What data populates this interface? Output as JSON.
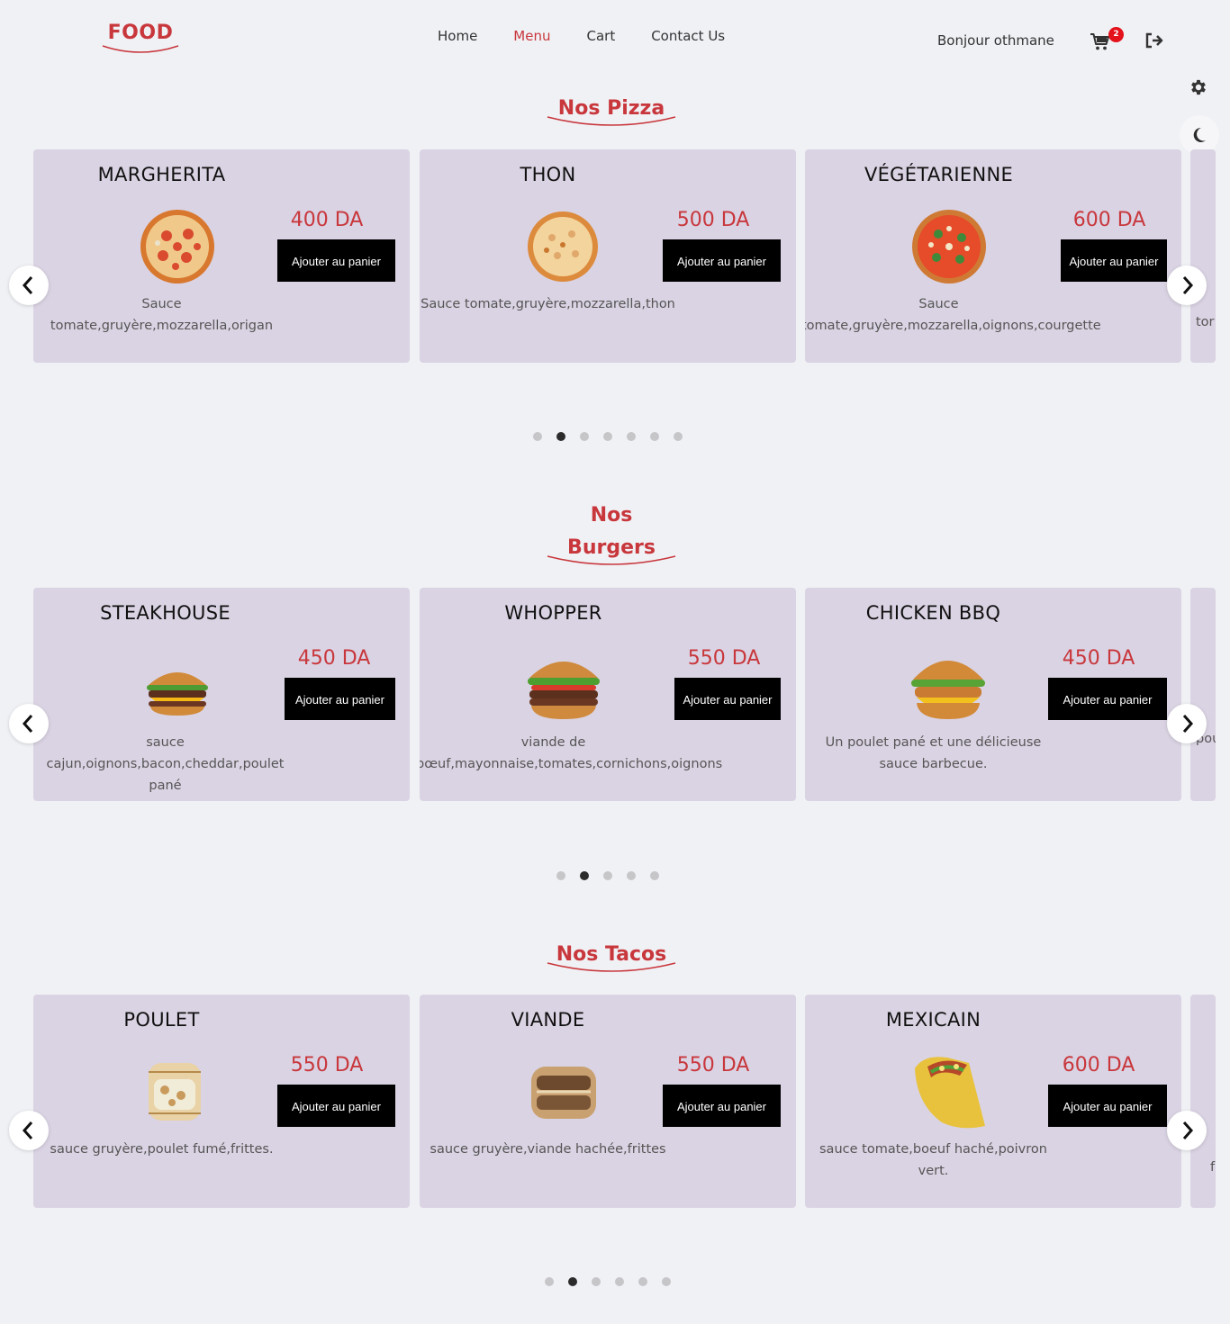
{
  "header": {
    "logo": "FOOD",
    "nav": [
      "Home",
      "Menu",
      "Cart",
      "Contact Us"
    ],
    "active_nav": "Menu",
    "greeting": "Bonjour othmane",
    "cart_count": "2"
  },
  "colors": {
    "accent": "#c8373c",
    "card_bg": "#dad3e3",
    "page_bg": "#f0f1f5",
    "button_bg": "#000000",
    "badge": "#e3121b"
  },
  "sections": [
    {
      "title": "Nos Pizza",
      "items": [
        {
          "name": "MARGHERITA",
          "price": "400 DA",
          "button": "Ajouter au panier",
          "desc": "Sauce tomate,gruyère,mozzarella,origan",
          "icon": "pizza-margherita-image"
        },
        {
          "name": "THON",
          "price": "500 DA",
          "button": "Ajouter au panier",
          "desc": "Sauce tomate,gruyère,mozzarella,thon",
          "icon": "pizza-thon-image"
        },
        {
          "name": "VÉGÉTARIENNE",
          "price": "600 DA",
          "button": "Ajouter au panier",
          "desc": "Sauce tomate,gruyère,mozzarella,oignons,courgette",
          "icon": "pizza-vegetarienne-image"
        }
      ],
      "peek_text": "tor",
      "dots": 7,
      "active_dot": 1
    },
    {
      "title": "Nos Burgers",
      "title_lines": [
        "Nos",
        "Burgers"
      ],
      "items": [
        {
          "name": "STEAKHOUSE",
          "price": "450 DA",
          "button": "Ajouter au panier",
          "desc": "sauce cajun,oignons,bacon,cheddar,poulet pané",
          "icon": "burger-steakhouse-image"
        },
        {
          "name": "WHOPPER",
          "price": "550 DA",
          "button": "Ajouter au panier",
          "desc": "viande de bœuf,mayonnaise,tomates,cornichons,oignons",
          "icon": "burger-whopper-image"
        },
        {
          "name": "CHICKEN BBQ",
          "price": "450 DA",
          "button": "Ajouter au panier",
          "desc": "Un poulet pané et une délicieuse sauce barbecue.",
          "icon": "burger-chicken-bbq-image"
        }
      ],
      "peek_text": "pou",
      "dots": 5,
      "active_dot": 1
    },
    {
      "title": "Nos Tacos",
      "items": [
        {
          "name": "POULET",
          "price": "550 DA",
          "button": "Ajouter au panier",
          "desc": "sauce gruyère,poulet fumé,frittes.",
          "icon": "tacos-poulet-image"
        },
        {
          "name": "VIANDE",
          "price": "550 DA",
          "button": "Ajouter au panier",
          "desc": "sauce gruyère,viande hachée,frittes",
          "icon": "tacos-viande-image"
        },
        {
          "name": "MEXICAIN",
          "price": "600 DA",
          "button": "Ajouter au panier",
          "desc": "sauce tomate,boeuf haché,poivron vert.",
          "icon": "tacos-mexicain-image"
        }
      ],
      "peek_text": "f",
      "dots": 6,
      "active_dot": 1
    }
  ]
}
